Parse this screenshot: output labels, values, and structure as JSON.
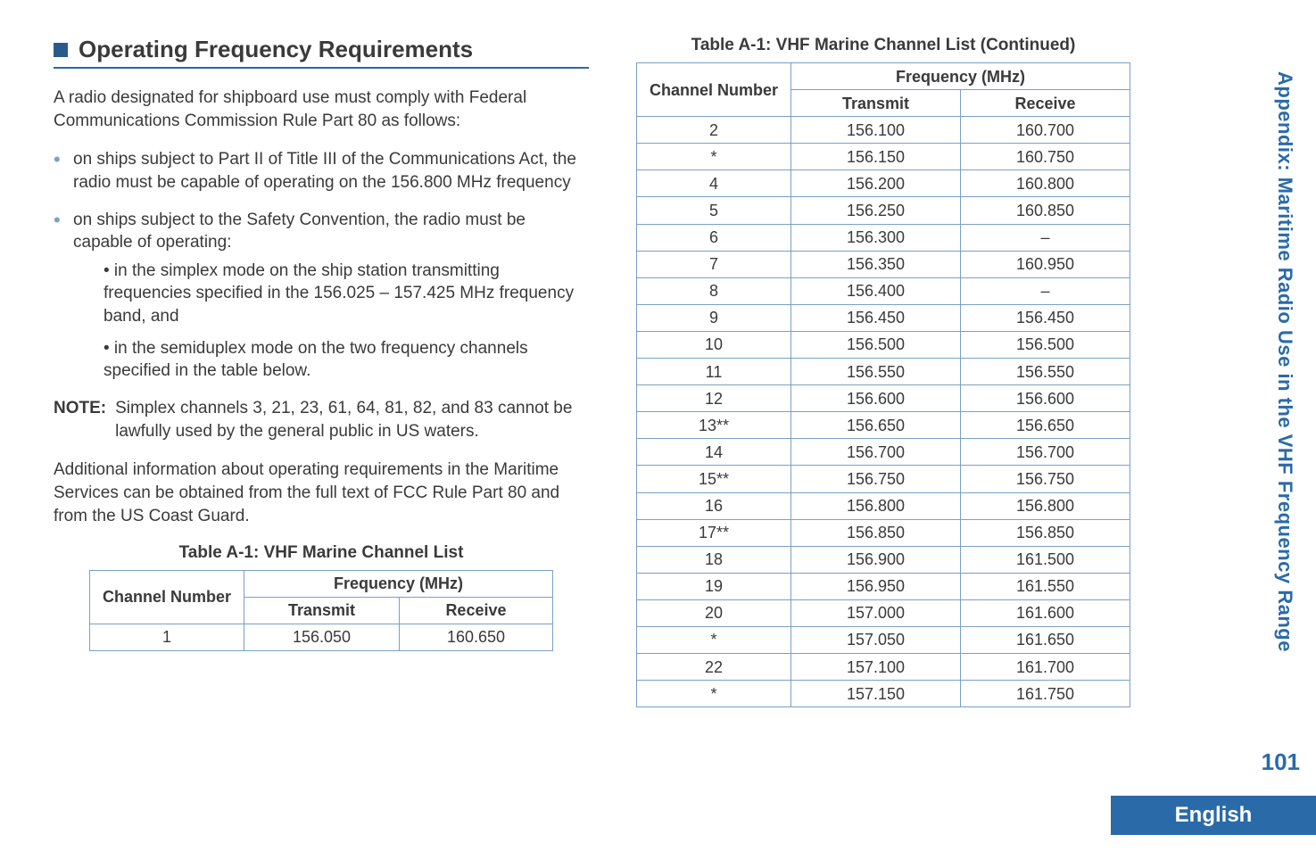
{
  "section": {
    "heading": "Operating Frequency Requirements",
    "intro": "A radio designated for shipboard use must comply with Federal Communications Commission Rule Part 80 as follows:",
    "bullets": [
      {
        "text": "on ships subject to Part II of Title III of the Communications Act, the radio must be capable of operating on the 156.800 MHz frequency"
      },
      {
        "text": "on ships subject to the Safety Convention, the radio must be capable of operating:",
        "sub": [
          "• in the simplex mode on the ship station transmitting frequencies specified in the 156.025 – 157.425 MHz frequency band, and",
          "• in the semiduplex mode on the two frequency channels specified in the table below."
        ]
      }
    ],
    "note_label": "NOTE:",
    "note_text": "Simplex channels 3, 21, 23, 61, 64, 81, 82, and 83 cannot be lawfully used by the general public in US waters.",
    "para2": "Additional information about operating requirements in the Maritime Services can be obtained from the full text of FCC Rule Part 80 and from the US Coast Guard."
  },
  "table_left": {
    "caption": "Table A-1: VHF Marine Channel List",
    "headers": {
      "ch": "Channel Number",
      "freq": "Frequency (MHz)",
      "tx": "Transmit",
      "rx": "Receive"
    },
    "rows": [
      {
        "ch": "1",
        "tx": "156.050",
        "rx": "160.650"
      }
    ]
  },
  "table_right": {
    "caption": "Table A-1: VHF Marine Channel List (Continued)",
    "headers": {
      "ch": "Channel Number",
      "freq": "Frequency (MHz)",
      "tx": "Transmit",
      "rx": "Receive"
    },
    "rows": [
      {
        "ch": "2",
        "tx": "156.100",
        "rx": "160.700"
      },
      {
        "ch": "*",
        "tx": "156.150",
        "rx": "160.750"
      },
      {
        "ch": "4",
        "tx": "156.200",
        "rx": "160.800"
      },
      {
        "ch": "5",
        "tx": "156.250",
        "rx": "160.850"
      },
      {
        "ch": "6",
        "tx": "156.300",
        "rx": "–"
      },
      {
        "ch": "7",
        "tx": "156.350",
        "rx": "160.950"
      },
      {
        "ch": "8",
        "tx": "156.400",
        "rx": "–"
      },
      {
        "ch": "9",
        "tx": "156.450",
        "rx": "156.450"
      },
      {
        "ch": "10",
        "tx": "156.500",
        "rx": "156.500"
      },
      {
        "ch": "11",
        "tx": "156.550",
        "rx": "156.550"
      },
      {
        "ch": "12",
        "tx": "156.600",
        "rx": "156.600"
      },
      {
        "ch": "13**",
        "tx": "156.650",
        "rx": "156.650"
      },
      {
        "ch": "14",
        "tx": "156.700",
        "rx": "156.700"
      },
      {
        "ch": "15**",
        "tx": "156.750",
        "rx": "156.750"
      },
      {
        "ch": "16",
        "tx": "156.800",
        "rx": "156.800"
      },
      {
        "ch": "17**",
        "tx": "156.850",
        "rx": "156.850"
      },
      {
        "ch": "18",
        "tx": "156.900",
        "rx": "161.500"
      },
      {
        "ch": "19",
        "tx": "156.950",
        "rx": "161.550"
      },
      {
        "ch": "20",
        "tx": "157.000",
        "rx": "161.600"
      },
      {
        "ch": "*",
        "tx": "157.050",
        "rx": "161.650"
      },
      {
        "ch": "22",
        "tx": "157.100",
        "rx": "161.700"
      },
      {
        "ch": "*",
        "tx": "157.150",
        "rx": "161.750"
      }
    ]
  },
  "side": {
    "label": "Appendix: Maritime Radio Use in the VHF Frequency Range",
    "page_num": "101",
    "language": "English"
  }
}
